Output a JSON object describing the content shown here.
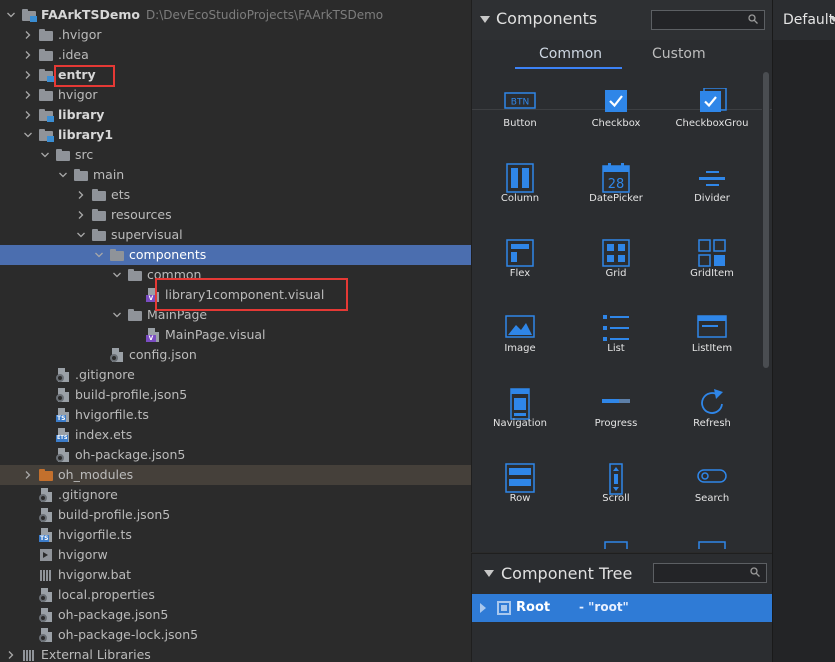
{
  "project_tree": {
    "rows": [
      {
        "label": "FAArkTSDemo",
        "path": "D:\\DevEcoStudioProjects\\FAArkTSDemo",
        "depth": 0,
        "arrow": "down",
        "icon": "module-folder",
        "bold": true
      },
      {
        "label": ".hvigor",
        "depth": 1,
        "arrow": "right",
        "icon": "folder"
      },
      {
        "label": ".idea",
        "depth": 1,
        "arrow": "right",
        "icon": "folder"
      },
      {
        "label": "entry",
        "depth": 1,
        "arrow": "right",
        "icon": "module-folder",
        "bold": true
      },
      {
        "label": "hvigor",
        "depth": 1,
        "arrow": "right",
        "icon": "folder"
      },
      {
        "label": "library",
        "depth": 1,
        "arrow": "right",
        "icon": "module-folder",
        "bold": true
      },
      {
        "label": "library1",
        "depth": 1,
        "arrow": "down",
        "icon": "module-folder",
        "bold": true
      },
      {
        "label": "src",
        "depth": 2,
        "arrow": "down",
        "icon": "folder"
      },
      {
        "label": "main",
        "depth": 3,
        "arrow": "down",
        "icon": "folder"
      },
      {
        "label": "ets",
        "depth": 4,
        "arrow": "right",
        "icon": "folder"
      },
      {
        "label": "resources",
        "depth": 4,
        "arrow": "right",
        "icon": "folder"
      },
      {
        "label": "supervisual",
        "depth": 4,
        "arrow": "down",
        "icon": "folder"
      },
      {
        "label": "components",
        "depth": 5,
        "arrow": "down",
        "icon": "folder",
        "selected": true
      },
      {
        "label": "common",
        "depth": 6,
        "arrow": "down",
        "icon": "folder"
      },
      {
        "label": "library1component.visual",
        "depth": 7,
        "arrow": "none",
        "icon": "visual-file"
      },
      {
        "label": "MainPage",
        "depth": 6,
        "arrow": "down",
        "icon": "folder"
      },
      {
        "label": "MainPage.visual",
        "depth": 7,
        "arrow": "none",
        "icon": "visual-file"
      },
      {
        "label": "config.json",
        "depth": 5,
        "arrow": "none",
        "icon": "config-file"
      },
      {
        "label": ".gitignore",
        "depth": 2,
        "arrow": "none",
        "icon": "config-file"
      },
      {
        "label": "build-profile.json5",
        "depth": 2,
        "arrow": "none",
        "icon": "config-file"
      },
      {
        "label": "hvigorfile.ts",
        "depth": 2,
        "arrow": "none",
        "icon": "ts-file"
      },
      {
        "label": "index.ets",
        "depth": 2,
        "arrow": "none",
        "icon": "ets-file"
      },
      {
        "label": "oh-package.json5",
        "depth": 2,
        "arrow": "none",
        "icon": "config-file"
      },
      {
        "label": "oh_modules",
        "depth": 1,
        "arrow": "right",
        "icon": "orange-folder",
        "modules": true
      },
      {
        "label": ".gitignore",
        "depth": 1,
        "arrow": "none",
        "icon": "config-file"
      },
      {
        "label": "build-profile.json5",
        "depth": 1,
        "arrow": "none",
        "icon": "config-file"
      },
      {
        "label": "hvigorfile.ts",
        "depth": 1,
        "arrow": "none",
        "icon": "ts-file"
      },
      {
        "label": "hvigorw",
        "depth": 1,
        "arrow": "none",
        "icon": "terminal-file"
      },
      {
        "label": "hvigorw.bat",
        "depth": 1,
        "arrow": "none",
        "icon": "bat-file"
      },
      {
        "label": "local.properties",
        "depth": 1,
        "arrow": "none",
        "icon": "config-file"
      },
      {
        "label": "oh-package.json5",
        "depth": 1,
        "arrow": "none",
        "icon": "config-file"
      },
      {
        "label": "oh-package-lock.json5",
        "depth": 1,
        "arrow": "none",
        "icon": "config-file"
      },
      {
        "label": "External Libraries",
        "depth": 0,
        "arrow": "right",
        "icon": "libraries"
      }
    ]
  },
  "components_panel": {
    "title": "Components",
    "search_placeholder": "",
    "tabs": [
      {
        "label": "Common",
        "active": true
      },
      {
        "label": "Custom",
        "active": false
      }
    ],
    "items": [
      {
        "label": "Button",
        "icon": "button-icon"
      },
      {
        "label": "Checkbox",
        "icon": "checkbox-icon"
      },
      {
        "label": "CheckboxGrou",
        "icon": "checkbox-group-icon"
      },
      {
        "label": "Column",
        "icon": "column-icon"
      },
      {
        "label": "DatePicker",
        "icon": "date-picker-icon",
        "day": "28"
      },
      {
        "label": "Divider",
        "icon": "divider-icon"
      },
      {
        "label": "Flex",
        "icon": "flex-icon"
      },
      {
        "label": "Grid",
        "icon": "grid-icon"
      },
      {
        "label": "GridItem",
        "icon": "grid-item-icon"
      },
      {
        "label": "Image",
        "icon": "image-icon"
      },
      {
        "label": "List",
        "icon": "list-icon"
      },
      {
        "label": "ListItem",
        "icon": "list-item-icon"
      },
      {
        "label": "Navigation",
        "icon": "navigation-icon"
      },
      {
        "label": "Progress",
        "icon": "progress-icon"
      },
      {
        "label": "Refresh",
        "icon": "refresh-icon"
      },
      {
        "label": "Row",
        "icon": "row-icon"
      },
      {
        "label": "Scroll",
        "icon": "scroll-icon"
      },
      {
        "label": "Search",
        "icon": "search-component-icon"
      }
    ],
    "button_icon_text": "BTN"
  },
  "component_tree": {
    "title": "Component Tree",
    "search_placeholder": "",
    "root": {
      "name": "Root",
      "value": "- \"root\""
    }
  },
  "editor": {
    "device_label": "Default"
  },
  "colors": {
    "accent": "#3c82f6",
    "selected_row": "#4b6eaf",
    "highlight_box": "#e53935",
    "icon_blue": "#2f86e8"
  }
}
